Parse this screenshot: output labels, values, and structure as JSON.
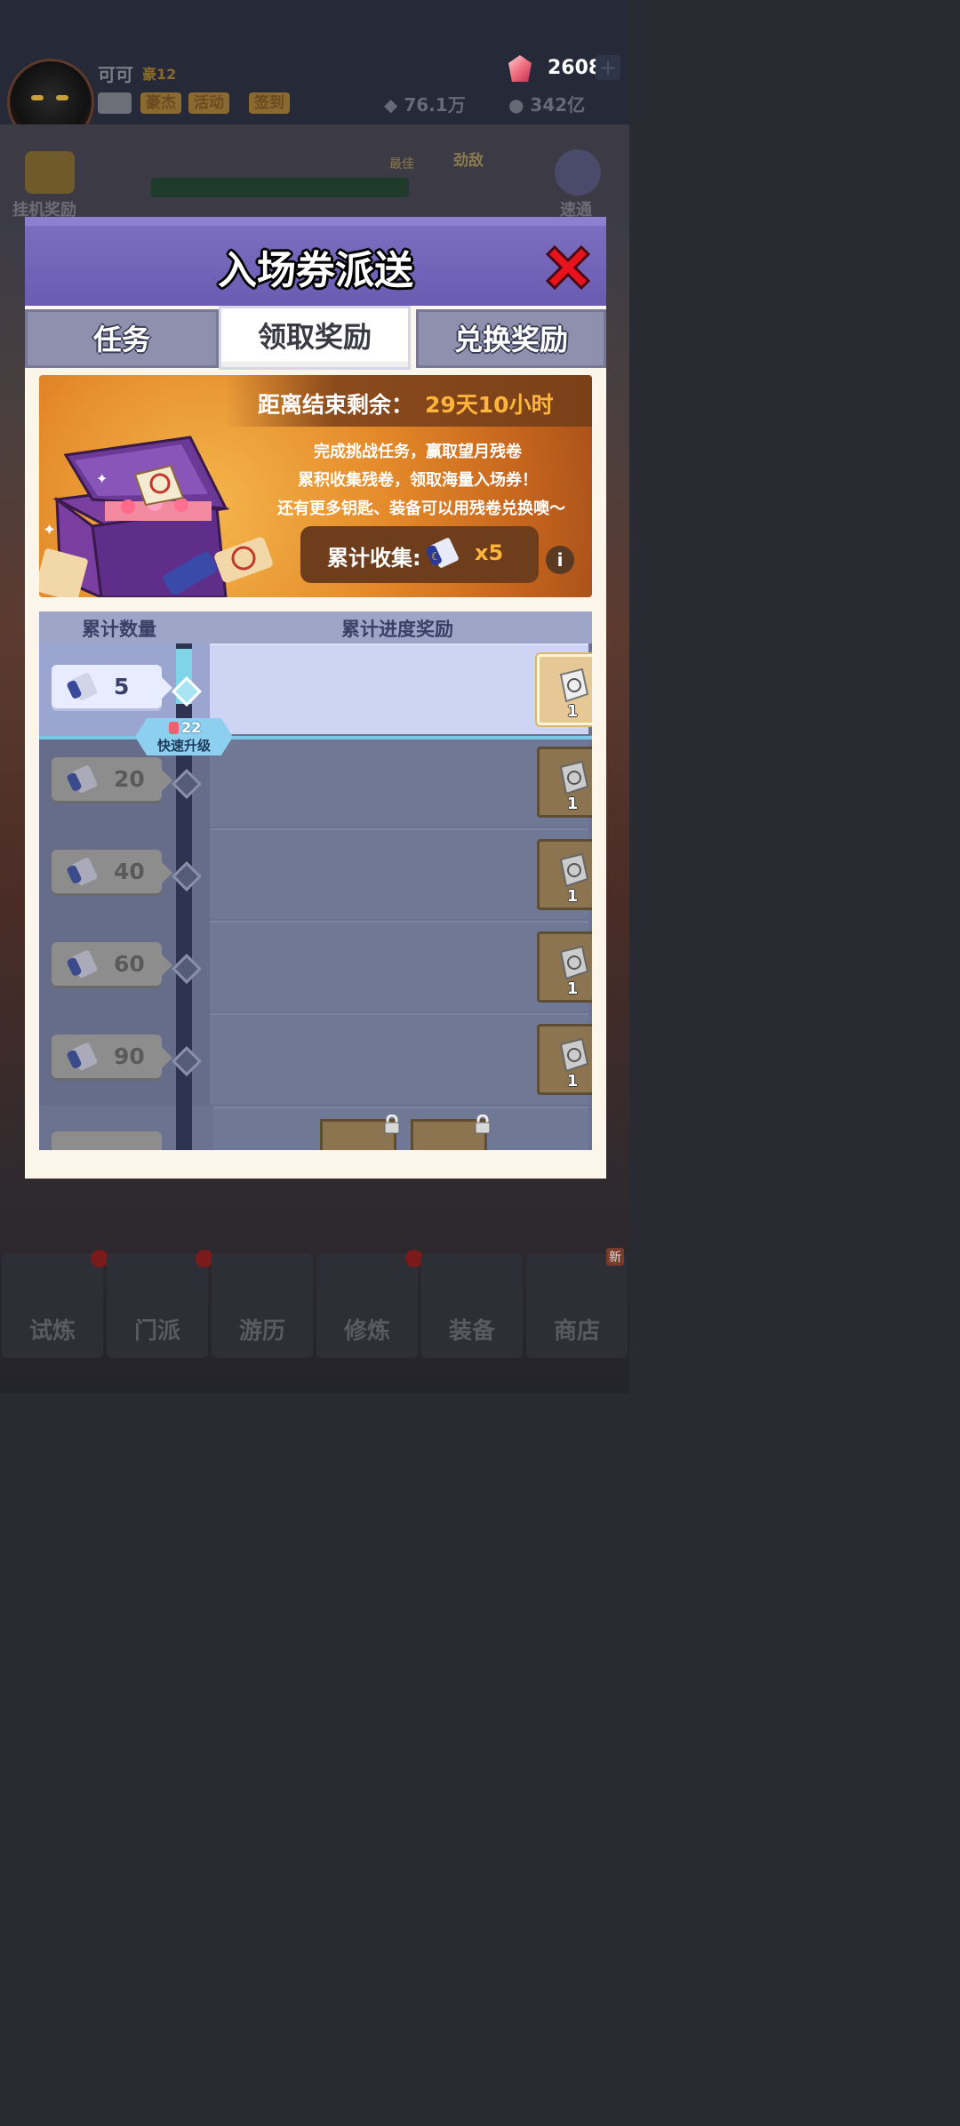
{
  "background": {
    "player_name": "可可",
    "player_rank": "豪12",
    "tags": [
      "豪杰",
      "活动",
      "签到"
    ],
    "gems": "2608",
    "power": "76.1万",
    "gold": "342亿",
    "idle_reward_label": "挂机奖励",
    "best_label": "最佳",
    "enemy_label": "劲敌",
    "clear_label": "速通"
  },
  "modal": {
    "title": "入场券派送",
    "tabs": [
      {
        "label": "任务",
        "active": false
      },
      {
        "label": "领取奖励",
        "active": true
      },
      {
        "label": "兑换奖励",
        "active": false
      }
    ],
    "banner": {
      "countdown_label": "距离结束剩余：",
      "countdown_value": "29天10小时",
      "lines": [
        "完成挑战任务，赢取望月残卷",
        "累积收集残卷，领取海量入场券！",
        "还有更多钥匙、装备可以用残卷兑换噢～"
      ],
      "collect_label": "累计收集:",
      "collect_count": "x5"
    },
    "table": {
      "headers": [
        "累计数量",
        "累计进度奖励"
      ],
      "rows": [
        {
          "threshold": "5",
          "reward_qty": "1",
          "status": "claimable"
        },
        {
          "threshold": "20",
          "reward_qty": "1",
          "status": "locked"
        },
        {
          "threshold": "40",
          "reward_qty": "1",
          "status": "locked"
        },
        {
          "threshold": "60",
          "reward_qty": "1",
          "status": "locked"
        },
        {
          "threshold": "90",
          "reward_qty": "1",
          "status": "locked"
        }
      ],
      "upgrade": {
        "cost": "22",
        "label": "快速升级"
      }
    }
  },
  "nav": [
    {
      "label": "试炼",
      "badge": "dot"
    },
    {
      "label": "门派",
      "badge": "dot"
    },
    {
      "label": "游历",
      "badge": ""
    },
    {
      "label": "修炼",
      "badge": "dot"
    },
    {
      "label": "装备",
      "badge": ""
    },
    {
      "label": "商店",
      "badge": "新"
    }
  ],
  "colors": {
    "header_purple": "#6a5cb1",
    "accent_orange": "#ffb43c",
    "claim_highlight": "#cdd4f4",
    "progress_cyan": "#7fd4e8",
    "notify_red": "#e8302e"
  }
}
